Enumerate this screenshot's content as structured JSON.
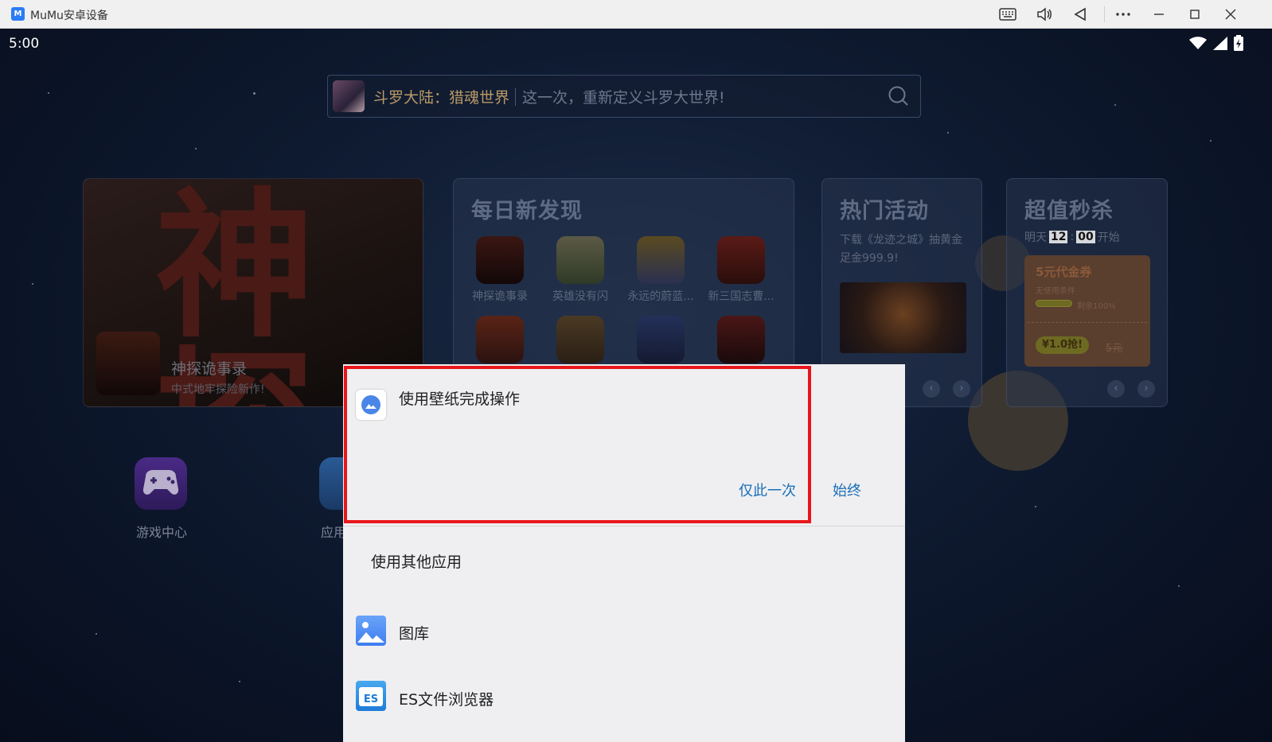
{
  "window": {
    "logo": "M",
    "title": "MuMu安卓设备",
    "icons": [
      "keyboard-icon",
      "volume-icon",
      "back-icon",
      "more-icon",
      "minimize-icon",
      "maximize-icon",
      "close-icon"
    ]
  },
  "status_bar": {
    "time": "5:00",
    "icons": [
      "wifi-icon",
      "signal-icon",
      "battery-icon"
    ]
  },
  "search": {
    "game_name": "斗罗大陆：猎魂世界",
    "slogan": "这一次，重新定义斗罗大世界!"
  },
  "featured": {
    "art_text": "神探",
    "game_name": "神探诡事录",
    "subtitle": "中式地牢探险新作!"
  },
  "daily": {
    "title": "每日新发现",
    "games": [
      "神探诡事录",
      "英雄没有闪",
      "永远的蔚蓝...",
      "新三国志曹..."
    ]
  },
  "activity": {
    "title": "热门活动",
    "text": "下载《龙迹之城》抽黄金足金999.9!"
  },
  "flash_sale": {
    "title": "超值秒杀",
    "day": "明天",
    "hour": "12",
    "minute": "00",
    "start": "开始",
    "coupon_title": "5元代金券",
    "coupon_condition": "无使用条件",
    "coupon_remaining": "剩余100%",
    "coupon_price": "¥1.0抢!",
    "coupon_original": "5元"
  },
  "desktop": {
    "game_center_label": "游戏中心",
    "app_label": "应用"
  },
  "dialog": {
    "title": "使用壁纸完成操作",
    "just_once": "仅此一次",
    "always": "始终",
    "use_other": "使用其他应用",
    "apps": [
      {
        "label": "图库",
        "icon": "gallery-icon"
      },
      {
        "label": "ES文件浏览器",
        "icon": "es-file-explorer-icon"
      }
    ]
  },
  "colors": {
    "accent_link": "#1a6fb8",
    "highlight_box": "#e8161a",
    "dialog_bg": "#efeff1"
  }
}
